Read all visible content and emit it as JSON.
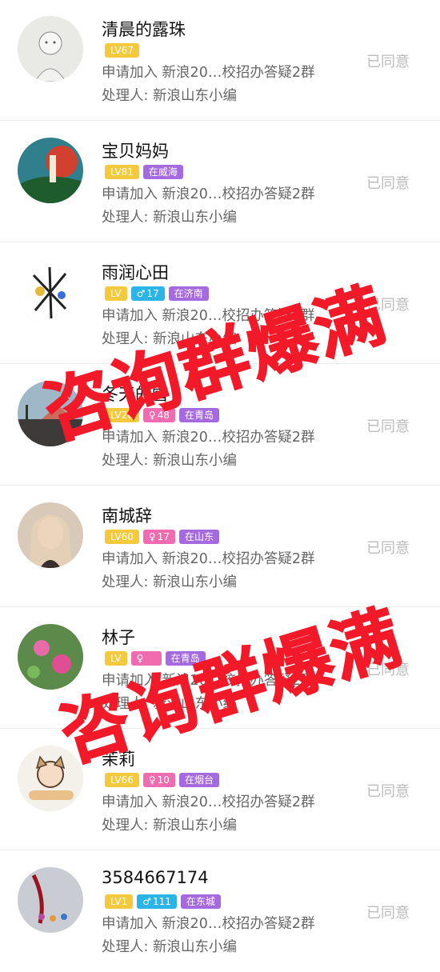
{
  "rows": [
    {
      "name": "清晨的露珠",
      "tags": [
        {
          "kind": "lv",
          "text": "LV67"
        }
      ],
      "request": "申请加入 新浪20…校招办答疑2群",
      "handler": "处理人:  新浪山东小编",
      "status": "已同意",
      "avatar_bg": "#e8e8e4"
    },
    {
      "name": "宝贝妈妈",
      "tags": [
        {
          "kind": "lv",
          "text": "LV81"
        },
        {
          "kind": "loc",
          "text": "在威海"
        }
      ],
      "request": "申请加入 新浪20…校招办答疑2群",
      "handler": "处理人:  新浪山东小编",
      "status": "已同意",
      "avatar_bg": "#2f7f8c"
    },
    {
      "name": "雨润心田",
      "tags": [
        {
          "kind": "lv",
          "text": "LV"
        },
        {
          "kind": "male",
          "text": "17"
        },
        {
          "kind": "loc",
          "text": "在济南"
        }
      ],
      "request": "申请加入 新浪20…校招办答疑2群",
      "handler": "处理人:  新浪山东小编",
      "status": "已同意",
      "avatar_bg": "#ffffff"
    },
    {
      "name": "冬天的雪",
      "tags": [
        {
          "kind": "lv",
          "text": "LV26"
        },
        {
          "kind": "female",
          "text": "48"
        },
        {
          "kind": "loc",
          "text": "在青岛"
        }
      ],
      "request": "申请加入 新浪20…校招办答疑2群",
      "handler": "处理人:  新浪山东小编",
      "status": "已同意",
      "avatar_bg": "#9fb8c8"
    },
    {
      "name": "南城辞",
      "tags": [
        {
          "kind": "lv",
          "text": "LV60"
        },
        {
          "kind": "female",
          "text": "17"
        },
        {
          "kind": "loc",
          "text": "在山东"
        }
      ],
      "request": "申请加入 新浪20…校招办答疑2群",
      "handler": "处理人:  新浪山东小编",
      "status": "已同意",
      "avatar_bg": "#d9c9b8"
    },
    {
      "name": "林子",
      "tags": [
        {
          "kind": "lv",
          "text": "LV"
        },
        {
          "kind": "female",
          "text": ""
        },
        {
          "kind": "loc",
          "text": "在青岛"
        }
      ],
      "request": "申请加入 新浪20…校招办答疑2群",
      "handler": "处理人:  新浪山东小编",
      "status": "已同意",
      "avatar_bg": "#5c8a4a"
    },
    {
      "name": "茉莉",
      "tags": [
        {
          "kind": "lv",
          "text": "LV66"
        },
        {
          "kind": "female",
          "text": "10"
        },
        {
          "kind": "loc",
          "text": "在烟台"
        }
      ],
      "request": "申请加入 新浪20…校招办答疑2群",
      "handler": "处理人:  新浪山东小编",
      "status": "已同意",
      "avatar_bg": "#f4f1ea"
    },
    {
      "name": "3584667174",
      "tags": [
        {
          "kind": "lv",
          "text": "LV1"
        },
        {
          "kind": "male",
          "text": "111"
        },
        {
          "kind": "loc",
          "text": "在东城"
        }
      ],
      "request": "申请加入 新浪20…校招办答疑2群",
      "handler": "处理人:  新浪山东小编",
      "status": "已同意",
      "avatar_bg": "#c9cdd3"
    }
  ],
  "watermarks": [
    "咨询群爆满",
    "咨询群爆满"
  ],
  "colors": {
    "watermark": "#f21a28",
    "lv": "#f5c93d",
    "female": "#f06bb0",
    "male": "#2bb4e8",
    "loc": "#a66ae0"
  }
}
